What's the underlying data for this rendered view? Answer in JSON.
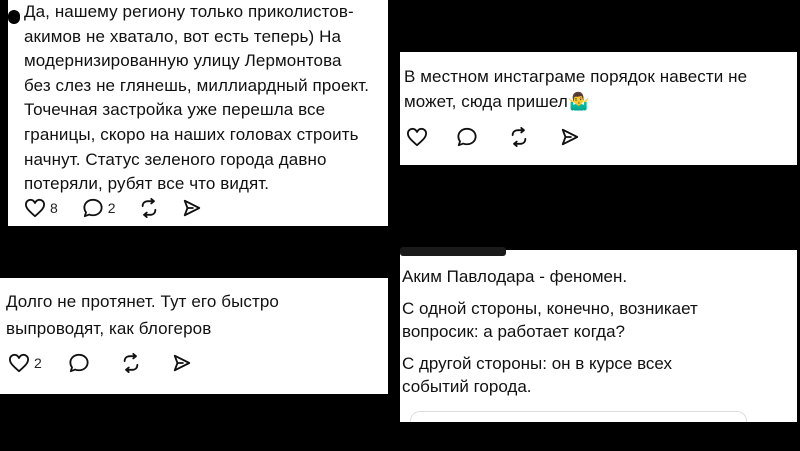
{
  "comments": [
    {
      "text": "Да, нашему региону только приколистов-\nакимов не хватало, вот есть теперь) На\nмодернизированную улицу Лермонтова\nбез слез не глянешь, миллиардный проект.\nТочечная застройка уже перешла все\nграницы, скоро на наших головах строить\nначнут. Статус зеленого города давно\nпотеряли, рубят все что видят.",
      "likes": "8",
      "replies": "2"
    },
    {
      "text": "В местном инстаграме порядок навести не\nможет, сюда пришел🤷‍♂️"
    },
    {
      "text": "Долго не протянет. Тут его быстро\nвыпроводят, как блогеров",
      "likes": "2"
    },
    {
      "paragraphs": [
        "Аким Павлодара - феномен.",
        "С одной стороны, конечно, возникает\nвопросик: а работает когда?",
        "С другой стороны: он в курсе всех\nсобытий города."
      ]
    }
  ],
  "icons": {
    "like": "heart-icon",
    "reply": "comment-icon",
    "repost": "repost-icon",
    "share": "send-icon"
  },
  "colors": {
    "background": "#000000",
    "card": "#ffffff",
    "text": "#111111"
  }
}
